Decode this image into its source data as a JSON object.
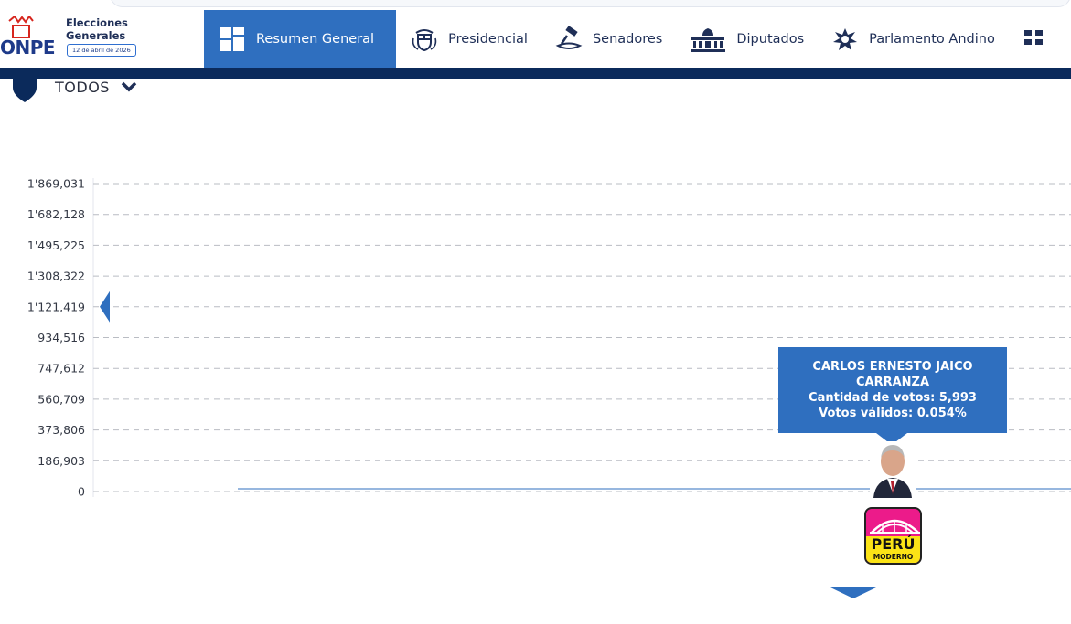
{
  "logo": {
    "brand": "ONPE",
    "title_line1": "Elecciones",
    "title_line2": "Generales",
    "date": "12 de abril de 2026"
  },
  "nav": {
    "items": [
      {
        "label": "Resumen General",
        "icon": "grid-icon",
        "active": true
      },
      {
        "label": "Presidencial",
        "icon": "coat-of-arms-icon",
        "active": false
      },
      {
        "label": "Senadores",
        "icon": "gavel-icon",
        "active": false
      },
      {
        "label": "Diputados",
        "icon": "congress-building-icon",
        "active": false
      },
      {
        "label": "Parlamento Andino",
        "icon": "condor-icon",
        "active": false
      }
    ]
  },
  "filter": {
    "label": "TODOS",
    "icon": "location-pin-icon"
  },
  "chart_data": {
    "type": "bar",
    "y_ticks": [
      "1'869,031",
      "1'682,128",
      "1'495,225",
      "1'308,322",
      "1'121,419",
      "934,516",
      "747,612",
      "560,709",
      "373,806",
      "186,903",
      "0"
    ],
    "ylim": [
      0,
      1869031
    ],
    "grid": true,
    "series": [
      {
        "candidate": "CARLOS ERNESTO JAICO CARRANZA",
        "party": "PERÚ MODERNO",
        "votes": 5993
      }
    ]
  },
  "tooltip": {
    "name_line1": "CARLOS ERNESTO JAICO",
    "name_line2": "CARRANZA",
    "votes_text": "Cantidad de votos: 5,993",
    "valid_text": "Votos válidos: 0.054%"
  },
  "party": {
    "brand": "PERÚ",
    "sub": "MODERNO"
  },
  "colors": {
    "primary": "#2f6fbf",
    "navy": "#0b2a5b",
    "party_pink": "#ec1b8a",
    "party_yellow": "#fbe316"
  }
}
